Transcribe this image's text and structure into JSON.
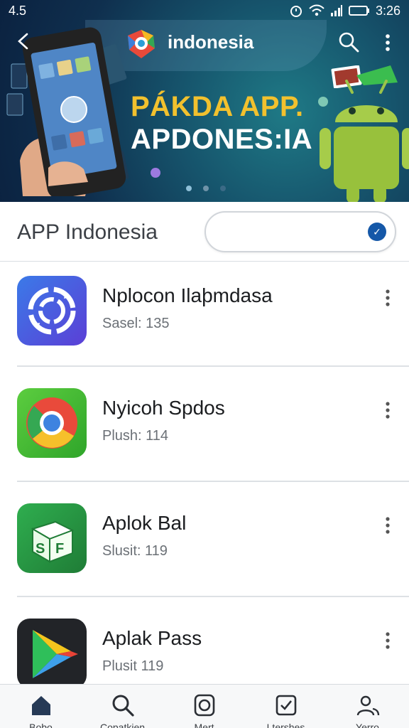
{
  "status_bar": {
    "time_left": "4.5",
    "time_right": "3:26"
  },
  "header": {
    "brand": "indonesia",
    "banner_line1": "PÁKDA APP.",
    "banner_line2": "APDONES:IA"
  },
  "page": {
    "title": "APP Indonesia",
    "search_placeholder": "",
    "search_value": ""
  },
  "apps": [
    {
      "name": "Nplocon Ilaþmdasa",
      "subtitle": "Sasel: 135",
      "icon": "sync-icon"
    },
    {
      "name": "Nyicoh Spdos",
      "subtitle": "Plush: 114",
      "icon": "chrome-icon"
    },
    {
      "name": "Aplok Bal",
      "subtitle": "Slusit: 119",
      "icon": "cube-sf-icon"
    },
    {
      "name": "Aplak Pass",
      "subtitle": "Plusit 119",
      "icon": "play-store-icon"
    }
  ],
  "bottom_nav": [
    {
      "label": "Bobo",
      "icon": "home-icon"
    },
    {
      "label": "Copatkien",
      "icon": "search-icon"
    },
    {
      "label": "Mert",
      "icon": "camera-icon"
    },
    {
      "label": "Ltershes",
      "icon": "checkbox-icon"
    },
    {
      "label": "Yerro",
      "icon": "people-icon"
    }
  ],
  "colors": {
    "hero_background": "#16546c",
    "banner_yellow": "#f2c12e",
    "accent_blue": "#1558a8",
    "text_dark": "#1b1d20",
    "text_muted": "#6b7076"
  }
}
